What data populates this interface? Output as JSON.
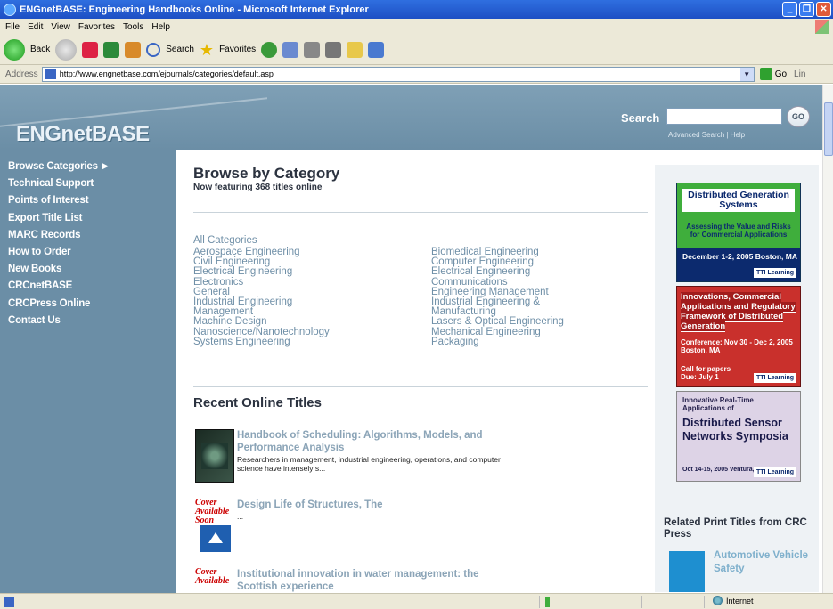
{
  "window": {
    "title": "ENGnetBASE: Engineering Handbooks Online - Microsoft Internet Explorer",
    "minimize": "_",
    "maximize": "❐",
    "close": "✕"
  },
  "menu": [
    "File",
    "Edit",
    "View",
    "Favorites",
    "Tools",
    "Help"
  ],
  "toolbar": {
    "back": "Back",
    "search": "Search",
    "favorites": "Favorites"
  },
  "addressbar": {
    "label": "Address",
    "url": "http://www.engnetbase.com/ejournals/categories/default.asp",
    "go": "Go",
    "links": "Lin"
  },
  "header": {
    "logo": "ENGnetBASE",
    "search_label": "Search",
    "go": "GO",
    "search_links": "Advanced Search  |  Help"
  },
  "nav": [
    "Browse Categories ►",
    "Technical Support",
    "Points of Interest",
    "Export Title List",
    "MARC Records",
    "How to Order",
    "New Books",
    "CRCnetBASE",
    "CRCPress Online",
    "Contact Us"
  ],
  "main": {
    "title": "Browse by Category",
    "subtitle": "Now featuring 368 titles online",
    "all_categories": "All Categories",
    "categories_col1": [
      "Aerospace Engineering",
      "Civil Engineering",
      "Electrical Engineering",
      "Electronics",
      "General",
      "Industrial Engineering",
      "Management",
      "Machine Design",
      "Nanoscience/Nanotechnology",
      "Systems Engineering"
    ],
    "categories_col2": [
      "Biomedical Engineering",
      "Computer Engineering",
      "Electrical Engineering",
      "Communications",
      "Engineering Management",
      "Industrial Engineering &",
      "Manufacturing",
      "Lasers & Optical Engineering",
      "Mechanical Engineering",
      "Packaging"
    ],
    "recent_title": "Recent Online Titles",
    "books": [
      {
        "title": "Handbook of Scheduling: Algorithms, Models, and Performance Analysis",
        "desc": "Researchers in management, industrial engineering, operations, and computer science have intensely s..."
      },
      {
        "title": "Design Life of Structures, The",
        "desc": "...",
        "cover_text": "Cover Available Soon"
      },
      {
        "title": "Institutional innovation in water management: the Scottish experience",
        "desc": "",
        "cover_text": "Cover Available"
      }
    ]
  },
  "right": {
    "ad1": {
      "head": "Distributed Generation Systems",
      "sub": "Assessing the Value and Risks for Commercial Applications",
      "date": "December 1-2, 2005 Boston, MA",
      "brand": "TTI Learning"
    },
    "ad2": {
      "head": "Innovations, Commercial Applications and Regulatory Framework of Distributed Generation",
      "conf": "Conference: Nov 30 - Dec 2, 2005 Boston, MA",
      "call": "Call for papers Due: July 1",
      "brand": "TTI Learning"
    },
    "ad3": {
      "kicker": "Innovative Real-Time Applications of",
      "head": "Distributed Sensor Networks Symposia",
      "date": "Oct 14-15, 2005 Ventura, CA",
      "brand": "TTI Learning"
    },
    "related_title": "Related Print Titles from CRC Press",
    "related_link": "Automotive Vehicle Safety"
  },
  "status": {
    "zone": "Internet"
  }
}
